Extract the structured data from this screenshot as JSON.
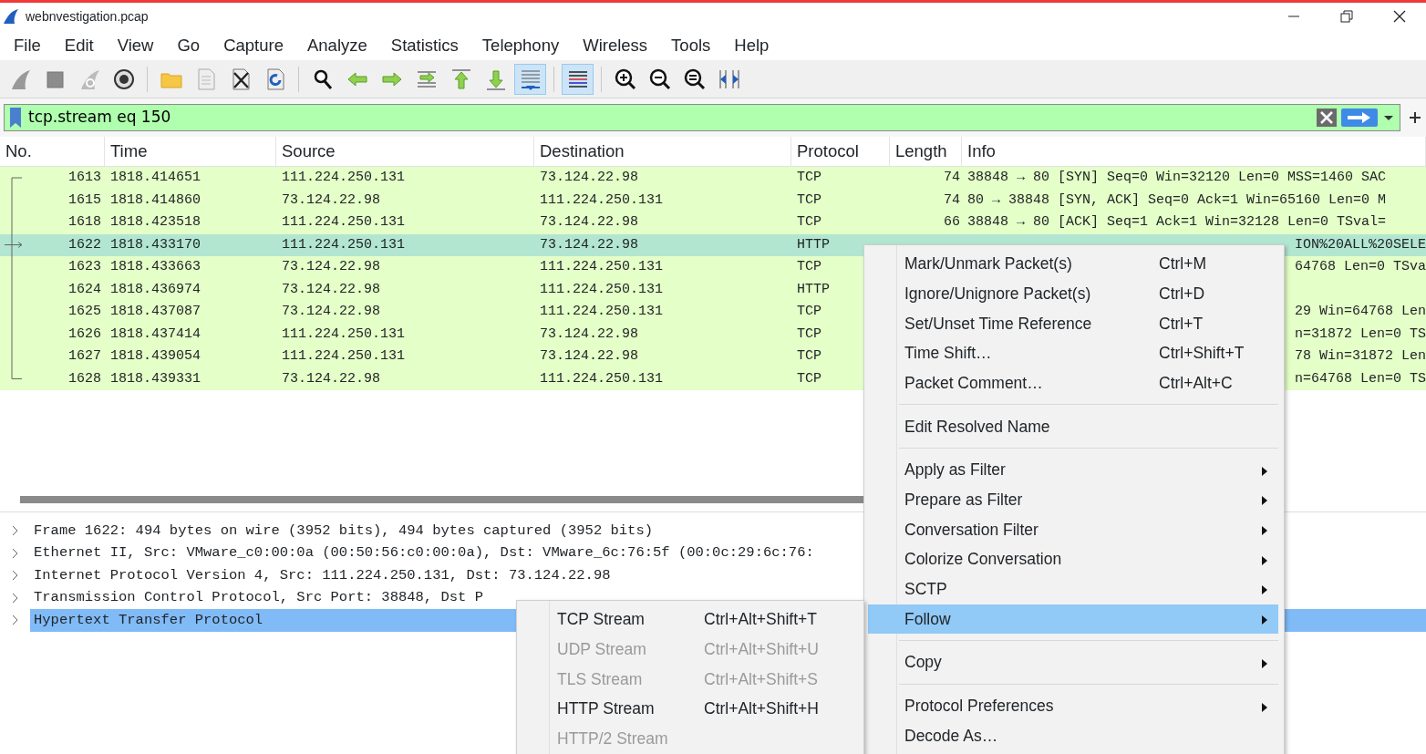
{
  "window": {
    "title": "webnvestigation.pcap"
  },
  "menu_bar": [
    "File",
    "Edit",
    "View",
    "Go",
    "Capture",
    "Analyze",
    "Statistics",
    "Telephony",
    "Wireless",
    "Tools",
    "Help"
  ],
  "toolbar": [
    {
      "kind": "start",
      "pressed": false
    },
    {
      "kind": "stop",
      "pressed": false
    },
    {
      "kind": "restart",
      "pressed": false
    },
    {
      "kind": "options",
      "pressed": false
    },
    {
      "kind": "separator"
    },
    {
      "kind": "open",
      "pressed": false
    },
    {
      "kind": "file",
      "pressed": false
    },
    {
      "kind": "close",
      "pressed": false
    },
    {
      "kind": "reload",
      "pressed": false
    },
    {
      "kind": "separator"
    },
    {
      "kind": "find",
      "pressed": false
    },
    {
      "kind": "back",
      "pressed": false
    },
    {
      "kind": "forward",
      "pressed": false
    },
    {
      "kind": "goto",
      "pressed": false
    },
    {
      "kind": "first",
      "pressed": false
    },
    {
      "kind": "last",
      "pressed": false
    },
    {
      "kind": "autoscroll",
      "pressed": true
    },
    {
      "kind": "separator"
    },
    {
      "kind": "colorize",
      "pressed": true
    },
    {
      "kind": "separator"
    },
    {
      "kind": "zoomin",
      "pressed": false
    },
    {
      "kind": "zoomout",
      "pressed": false
    },
    {
      "kind": "zoomreset",
      "pressed": false
    },
    {
      "kind": "resize",
      "pressed": false
    }
  ],
  "display_filter": {
    "value": "tcp.stream eq 150"
  },
  "packet_list": {
    "columns": [
      "No.",
      "Time",
      "Source",
      "Destination",
      "Protocol",
      "Length",
      "Info"
    ],
    "rows": [
      {
        "no": "1613",
        "time": "1818.414651",
        "source": "111.224.250.131",
        "destination": "73.124.22.98",
        "protocol": "TCP",
        "length": "74",
        "info": "38848 → 80 [SYN] Seq=0 Win=32120 Len=0 MSS=1460 SAC",
        "selected": false
      },
      {
        "no": "1615",
        "time": "1818.414860",
        "source": "73.124.22.98",
        "destination": "111.224.250.131",
        "protocol": "TCP",
        "length": "74",
        "info": "80 → 38848 [SYN, ACK] Seq=0 Ack=1 Win=65160 Len=0 M",
        "selected": false
      },
      {
        "no": "1618",
        "time": "1818.423518",
        "source": "111.224.250.131",
        "destination": "73.124.22.98",
        "protocol": "TCP",
        "length": "66",
        "info": "38848 → 80 [ACK] Seq=1 Ack=1 Win=32128 Len=0 TSval=",
        "selected": false
      },
      {
        "no": "1622",
        "time": "1818.433170",
        "source": "111.224.250.131",
        "destination": "73.124.22.98",
        "protocol": "HTTP",
        "info": "ION%20ALL%20SELE",
        "selected": true
      },
      {
        "no": "1623",
        "time": "1818.433663",
        "source": "73.124.22.98",
        "destination": "111.224.250.131",
        "protocol": "TCP",
        "info": "64768 Len=0 TSva",
        "selected": false
      },
      {
        "no": "1624",
        "time": "1818.436974",
        "source": "73.124.22.98",
        "destination": "111.224.250.131",
        "protocol": "HTTP",
        "selected": false
      },
      {
        "no": "1625",
        "time": "1818.437087",
        "source": "73.124.22.98",
        "destination": "111.224.250.131",
        "protocol": "TCP",
        "info": "29 Win=64768 Len",
        "selected": false
      },
      {
        "no": "1626",
        "time": "1818.437414",
        "source": "111.224.250.131",
        "destination": "73.124.22.98",
        "protocol": "TCP",
        "info": "n=31872 Len=0 TS",
        "selected": false
      },
      {
        "no": "1627",
        "time": "1818.439054",
        "source": "111.224.250.131",
        "destination": "73.124.22.98",
        "protocol": "TCP",
        "info": "78 Win=31872 Len",
        "selected": false
      },
      {
        "no": "1628",
        "time": "1818.439331",
        "source": "73.124.22.98",
        "destination": "111.224.250.131",
        "protocol": "TCP",
        "info": "n=64768 Len=0 TS",
        "selected": false
      }
    ]
  },
  "packet_details": [
    {
      "text": "Frame 1622: 494 bytes on wire (3952 bits), 494 bytes captured (3952 bits)",
      "selected": false
    },
    {
      "text": "Ethernet II, Src: VMware_c0:00:0a (00:50:56:c0:00:0a), Dst: VMware_6c:76:5f (00:0c:29:6c:76:",
      "selected": false
    },
    {
      "text": "Internet Protocol Version 4, Src: 111.224.250.131, Dst: 73.124.22.98",
      "selected": false
    },
    {
      "text": "Transmission Control Protocol, Src Port: 38848, Dst P",
      "selected": false
    },
    {
      "text": "Hypertext Transfer Protocol",
      "selected": true
    }
  ],
  "context_menu": {
    "items": [
      {
        "kind": "item",
        "label": "Mark/Unmark Packet(s)",
        "shortcut": "Ctrl+M",
        "submenu": false,
        "selected": false
      },
      {
        "kind": "item",
        "label": "Ignore/Unignore Packet(s)",
        "shortcut": "Ctrl+D",
        "submenu": false,
        "selected": false
      },
      {
        "kind": "item",
        "label": "Set/Unset Time Reference",
        "shortcut": "Ctrl+T",
        "submenu": false,
        "selected": false
      },
      {
        "kind": "item",
        "label": "Time Shift…",
        "shortcut": "Ctrl+Shift+T",
        "submenu": false,
        "selected": false
      },
      {
        "kind": "item",
        "label": "Packet Comment…",
        "shortcut": "Ctrl+Alt+C",
        "submenu": false,
        "selected": false
      },
      {
        "kind": "separator"
      },
      {
        "kind": "item",
        "label": "Edit Resolved Name",
        "submenu": false,
        "selected": false
      },
      {
        "kind": "separator"
      },
      {
        "kind": "item",
        "label": "Apply as Filter",
        "submenu": true,
        "selected": false
      },
      {
        "kind": "item",
        "label": "Prepare as Filter",
        "submenu": true,
        "selected": false
      },
      {
        "kind": "item",
        "label": "Conversation Filter",
        "submenu": true,
        "selected": false
      },
      {
        "kind": "item",
        "label": "Colorize Conversation",
        "submenu": true,
        "selected": false
      },
      {
        "kind": "item",
        "label": "SCTP",
        "submenu": true,
        "selected": false
      },
      {
        "kind": "item",
        "label": "Follow",
        "submenu": true,
        "selected": true
      },
      {
        "kind": "separator"
      },
      {
        "kind": "item",
        "label": "Copy",
        "submenu": true,
        "selected": false
      },
      {
        "kind": "separator"
      },
      {
        "kind": "item",
        "label": "Protocol Preferences",
        "submenu": true,
        "selected": false
      },
      {
        "kind": "item",
        "label": "Decode As…",
        "submenu": false,
        "selected": false
      }
    ]
  },
  "follow_submenu": {
    "items": [
      {
        "label": "TCP Stream",
        "shortcut": "Ctrl+Alt+Shift+T",
        "disabled": false
      },
      {
        "label": "UDP Stream",
        "shortcut": "Ctrl+Alt+Shift+U",
        "disabled": true
      },
      {
        "label": "TLS Stream",
        "shortcut": "Ctrl+Alt+Shift+S",
        "disabled": true
      },
      {
        "label": "HTTP Stream",
        "shortcut": "Ctrl+Alt+Shift+H",
        "disabled": false
      },
      {
        "label": "HTTP/2 Stream",
        "disabled": true
      }
    ]
  }
}
